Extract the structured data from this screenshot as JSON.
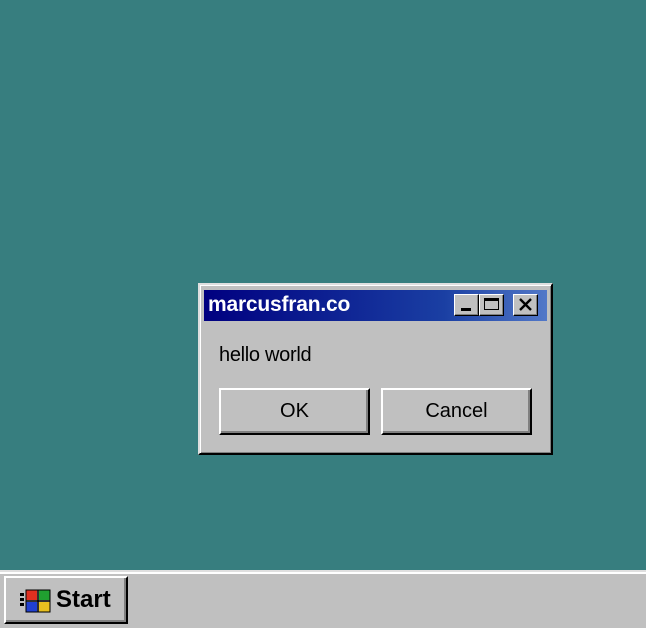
{
  "dialog": {
    "title": "marcusfran.co",
    "message": "hello world",
    "ok_label": "OK",
    "cancel_label": "Cancel"
  },
  "taskbar": {
    "start_label": "Start"
  },
  "icons": {
    "minimize": "minimize-icon",
    "maximize": "maximize-icon",
    "close": "close-icon",
    "start": "windows-logo-icon"
  },
  "colors": {
    "desktop": "#377e7f",
    "titlebar_start": "#000080",
    "titlebar_end": "#5278c8",
    "face": "#c0c0c0"
  }
}
